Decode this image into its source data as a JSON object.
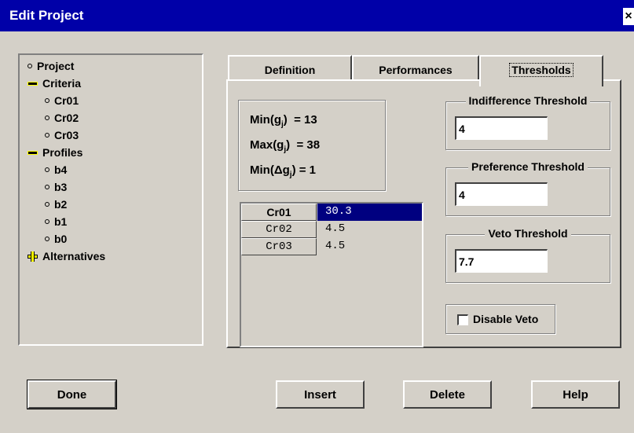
{
  "window": {
    "title": "Edit Project",
    "close_glyph": "×"
  },
  "tree": [
    {
      "label": "Project",
      "icon": "dot"
    },
    {
      "label": "Criteria",
      "icon": "minus"
    },
    {
      "label": "Cr01",
      "icon": "dot"
    },
    {
      "label": "Cr02",
      "icon": "dot"
    },
    {
      "label": "Cr03",
      "icon": "dot"
    },
    {
      "label": "Profiles",
      "icon": "minus"
    },
    {
      "label": "b4",
      "icon": "dot"
    },
    {
      "label": "b3",
      "icon": "dot"
    },
    {
      "label": "b2",
      "icon": "dot"
    },
    {
      "label": "b1",
      "icon": "dot"
    },
    {
      "label": "b0",
      "icon": "dot"
    },
    {
      "label": "Alternatives",
      "icon": "plus"
    }
  ],
  "tabs": [
    {
      "label": "Definition"
    },
    {
      "label": "Performances"
    },
    {
      "label": "Thresholds"
    }
  ],
  "stats": {
    "min_label": "Min",
    "min_value": "= 13",
    "max_label": "Max",
    "max_value": "= 38",
    "mindelta_label": "Min",
    "mindelta_value": "= 1",
    "g_sub": "j"
  },
  "grid": [
    {
      "criterion": "Cr01",
      "value": "30.3",
      "selected": true
    },
    {
      "criterion": "Cr02",
      "value": "4.5"
    },
    {
      "criterion": "Cr03",
      "value": "4.5"
    }
  ],
  "thresholds": {
    "indifference": {
      "label": "Indifference Threshold",
      "value": "4"
    },
    "preference": {
      "label": "Preference Threshold",
      "value": "4"
    },
    "veto": {
      "label": "Veto Threshold",
      "value": "7.7"
    }
  },
  "disable_veto": {
    "label": "Disable Veto",
    "checked": false
  },
  "buttons": {
    "done": "Done",
    "insert": "Insert",
    "delete": "Delete",
    "help": "Help"
  }
}
